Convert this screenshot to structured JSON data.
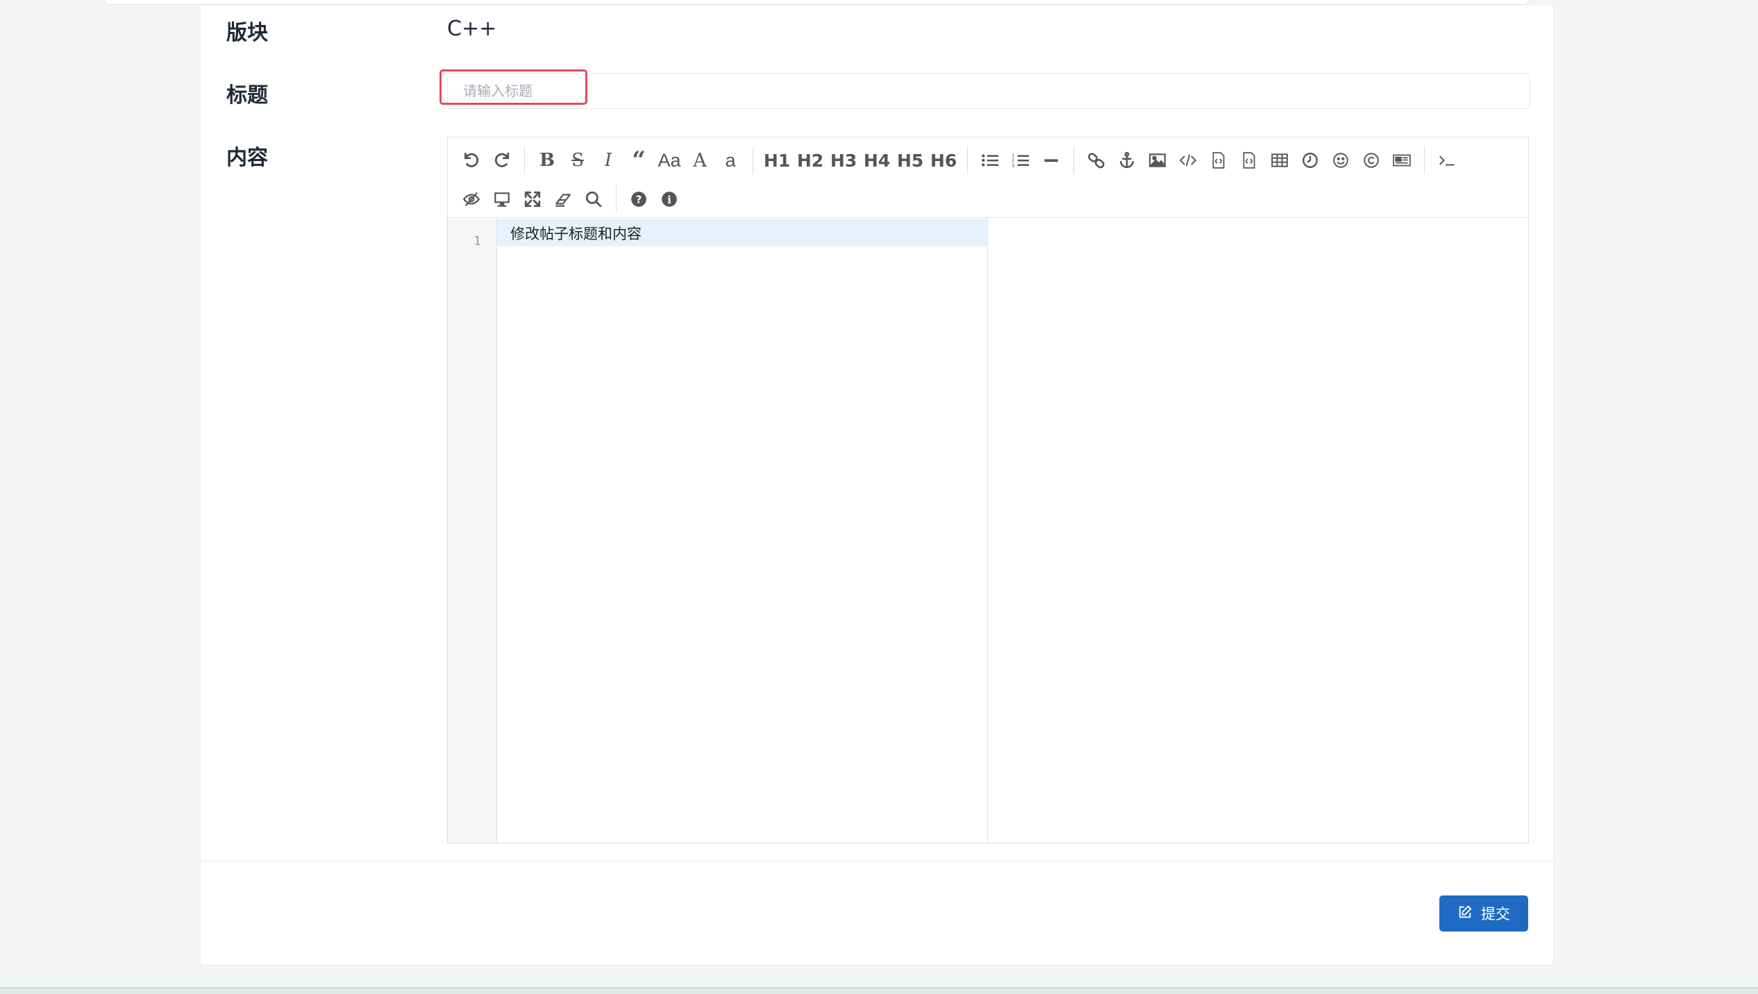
{
  "form": {
    "board_label": "版块",
    "board_value": "C++",
    "title_label": "标题",
    "title_placeholder": "请输入标题",
    "title_value": "",
    "content_label": "内容"
  },
  "toolbar": {
    "heading_buttons": [
      "H1",
      "H2",
      "H3",
      "H4",
      "H5",
      "H6"
    ],
    "case_button": "Aa",
    "upper_button": "A",
    "lower_button": "a"
  },
  "editor": {
    "line_number": "1",
    "line_text": "修改帖子标题和内容"
  },
  "submit": {
    "label": "提交"
  },
  "colors": {
    "primary": "#1f6bc4",
    "focus": "#e5475f"
  }
}
